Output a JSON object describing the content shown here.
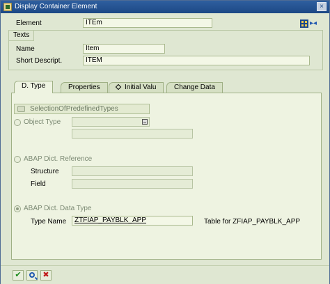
{
  "window": {
    "title": "Display Container Element",
    "close_label": "×"
  },
  "header": {
    "element_label": "Element",
    "element_value": "ITEm"
  },
  "texts": {
    "group_title": "Texts",
    "name_label": "Name",
    "name_value": "Item",
    "short_label": "Short Descript.",
    "short_value": "ITEM"
  },
  "tabs": [
    {
      "label": "D. Type",
      "active": true
    },
    {
      "label": "Properties"
    },
    {
      "label": "Initial Valu"
    },
    {
      "label": "Change Data"
    }
  ],
  "dtype": {
    "predefined_button": "SelectionOfPredefinedTypes",
    "object_type_label": "Object Type",
    "abap_dict_ref_label": "ABAP Dict. Reference",
    "structure_label": "Structure",
    "field_label": "Field",
    "abap_dict_data_type_label": "ABAP Dict. Data Type",
    "type_name_label": "Type Name",
    "type_name_value": "ZTFIAP_PAYBLK_APP",
    "type_description": "Table for ZFIAP_PAYBLK_APP"
  },
  "footer": {
    "ok_icon": "check-icon",
    "find_icon": "magnifier-icon",
    "cancel_icon": "x-icon"
  },
  "colors": {
    "titlebar": "#1c4885",
    "panel": "#eef3e1",
    "background": "#dfe7d2"
  }
}
